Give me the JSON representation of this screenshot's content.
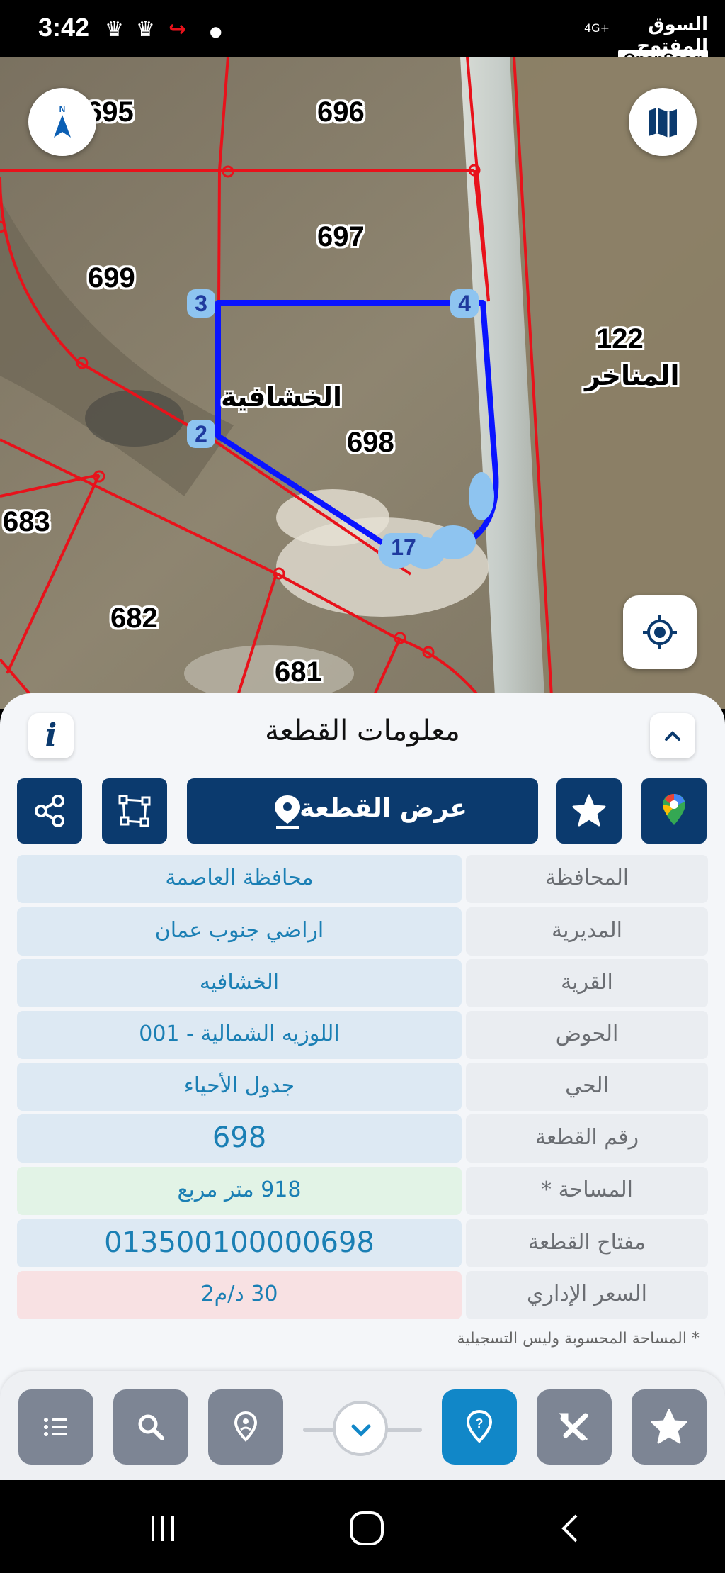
{
  "status_bar": {
    "time": "3:42",
    "icons": [
      "snapchat-icon",
      "snapchat-icon",
      "app-notification-icon",
      "dot-icon"
    ],
    "network": "4G+",
    "watermark_ar": "السوق المفتوح",
    "watermark_en": "OpenSooq"
  },
  "map": {
    "parcels": [
      "695",
      "696",
      "697",
      "699",
      "698",
      "683",
      "682",
      "681",
      "122"
    ],
    "village_label": "الخشافية",
    "area_label": "المناخر",
    "vertices": [
      "3",
      "4",
      "2",
      "17"
    ],
    "accent_blue": "#0a14ff",
    "boundary_red": "#e8121b"
  },
  "sheet": {
    "title": "معلومات القطعة",
    "view_button": "عرض القطعة",
    "info_icon": "i",
    "rows": [
      {
        "label": "المحافظة",
        "value": "محافظة العاصمة",
        "tone": "blue"
      },
      {
        "label": "المديرية",
        "value": "اراضي جنوب عمان",
        "tone": "blue"
      },
      {
        "label": "القرية",
        "value": "الخشافيه",
        "tone": "blue"
      },
      {
        "label": "الحوض",
        "value": "اللوزيه الشمالية - 001",
        "tone": "blue"
      },
      {
        "label": "الحي",
        "value": "جدول الأحياء",
        "tone": "blue"
      },
      {
        "label": "رقم القطعة",
        "value": "698",
        "tone": "blue"
      },
      {
        "label": "المساحة *",
        "value": "918  متر مربع",
        "tone": "green"
      },
      {
        "label": "مفتاح القطعة",
        "value": "013500100000698",
        "tone": "blue"
      },
      {
        "label": "السعر الإداري",
        "value": "30 د/م2",
        "tone": "red"
      }
    ],
    "footnote": "* المساحة المحسوبة وليس التسجيلية",
    "row_colors": {
      "blue": "#dde9f3",
      "green": "#e2f3e6",
      "red": "#f8e1e3"
    }
  },
  "toolbar": {
    "buttons": [
      "list-icon",
      "search-icon",
      "location-pin-icon",
      "help-icon",
      "tools-icon",
      "favorites-star-icon"
    ],
    "active": "help-icon"
  }
}
